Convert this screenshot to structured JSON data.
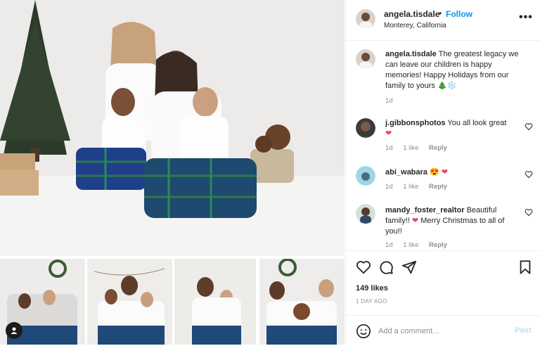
{
  "post": {
    "username": "angela.tisdale",
    "dot": "•",
    "follow_label": "Follow",
    "location": "Monterey, California",
    "more_label": "•••"
  },
  "caption": {
    "username": "angela.tisdale",
    "text": "The greatest legacy we can leave our children is happy memories! Happy Holidays from our family to yours 🎄❄️",
    "time": "1d"
  },
  "comments": [
    {
      "username": "j.gibbonsphotos",
      "text": "You all look great",
      "emoji": "❤",
      "time": "1d",
      "likes": "1 like",
      "reply": "Reply"
    },
    {
      "username": "abi_wabara",
      "text": "",
      "emoji": "😍 ❤",
      "time": "1d",
      "likes": "1 like",
      "reply": "Reply"
    },
    {
      "username": "mandy_foster_realtor",
      "text": "Beautiful family!!",
      "emoji": "❤",
      "text2": "Merry Christmas to all of you!!",
      "time": "1d",
      "likes": "1 like",
      "reply": "Reply"
    }
  ],
  "actions": {
    "likes": "149 likes",
    "time_ago": "1 DAY AGO",
    "icons": [
      "heart-icon",
      "comment-icon",
      "share-icon",
      "bookmark-icon"
    ]
  },
  "add_comment": {
    "placeholder": "Add a comment...",
    "post_label": "Post"
  },
  "colors": {
    "accent": "#0095f6",
    "post_disabled": "#b2dffc",
    "like_red": "#ed4956",
    "muted": "#8e8e8e"
  }
}
